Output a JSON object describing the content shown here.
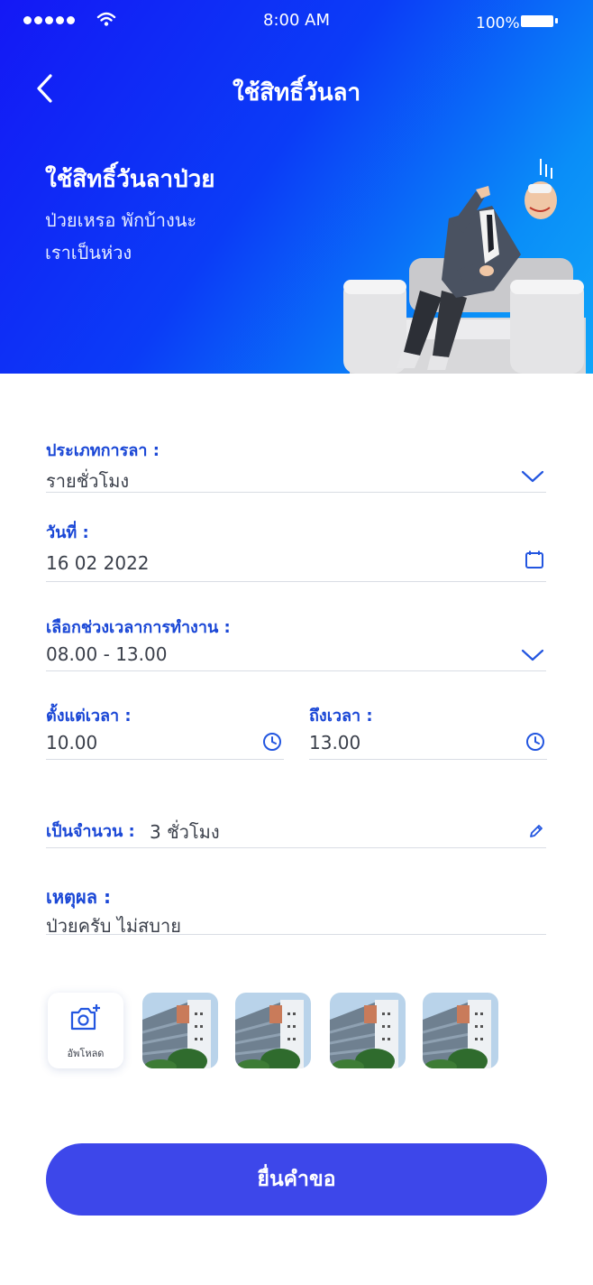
{
  "status_bar": {
    "time": "8:00 AM",
    "battery": "100%"
  },
  "header": {
    "title": "ใช้สิทธิ์วันลา",
    "heading": "ใช้สิทธิ์วันลาป่วย",
    "sub_line1": "ป่วยเหรอ พักบ้างนะ",
    "sub_line2": "เราเป็นห่วง"
  },
  "form": {
    "leave_type": {
      "label": "ประเภทการลา :",
      "value": "รายชั่วโมง"
    },
    "date": {
      "label": "วันที่ :",
      "value": "16 02 2022"
    },
    "work_period": {
      "label": "เลือกช่วงเวลาการทำงาน :",
      "value": "08.00 - 13.00"
    },
    "from_time": {
      "label": "ตั้งแต่เวลา :",
      "value": "10.00"
    },
    "to_time": {
      "label": "ถึงเวลา :",
      "value": "13.00"
    },
    "duration": {
      "label": "เป็นจำนวน :",
      "value": "3 ชั่วโมง"
    },
    "reason": {
      "label": "เหตุผล :",
      "value": "ป่วยครับ ไม่สบาย"
    }
  },
  "upload": {
    "label": "อัพโหลด",
    "thumbnail_count": 4
  },
  "submit_label": "ยื่นคำขอ",
  "colors": {
    "accent": "#1a47d6",
    "button": "#3d47ea",
    "hero_start": "#1418f5",
    "hero_end": "#10a6f9"
  },
  "icons": [
    "back-chevron-icon",
    "chevron-down-icon",
    "calendar-icon",
    "clock-icon",
    "pencil-icon",
    "camera-plus-icon",
    "wifi-icon",
    "battery-icon"
  ]
}
